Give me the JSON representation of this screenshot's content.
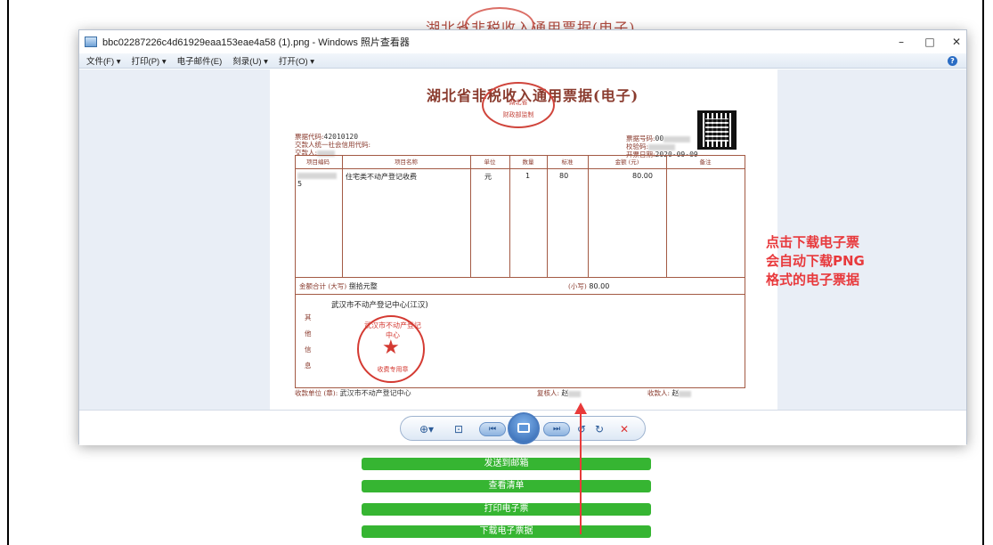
{
  "background": {
    "title": "湖北省非税收入通用票据(电子)"
  },
  "window": {
    "title": "bbc02287226c4d61929eaa153eae4a58 (1).png - Windows 照片查看器",
    "minimize": "–",
    "maximize": "□",
    "close": "✕",
    "help": "?",
    "menu": [
      "文件(F) ▾",
      "打印(P) ▾",
      "电子邮件(E)",
      "刻录(U) ▾",
      "打开(O) ▾"
    ]
  },
  "receipt": {
    "title": "湖北省非税收入通用票据(电子)",
    "seal_text": [
      "湖北省",
      "财政部监制"
    ],
    "left_info": {
      "code_label": "票据代码:",
      "code_value": "42010120",
      "payer_credit_label": "交款人统一社会信用代码:",
      "payer_label": "交款人:"
    },
    "right_info": {
      "number_label": "票据号码:",
      "number_value": "00",
      "check_label": "校验码:",
      "date_label": "开票日期:",
      "date_value": "2020-09-09"
    },
    "headers": [
      "项目编码",
      "项目名称",
      "单位",
      "数量",
      "标准",
      "金额 (元)",
      "备注"
    ],
    "row": {
      "code_tail": "5",
      "name": "住宅类不动产登记收费",
      "unit": "元",
      "qty": "1",
      "standard": "80",
      "amount": "80.00"
    },
    "total_label": "金额合计 (大写)",
    "total_words": "捌拾元整",
    "total_small_label": "(小写)",
    "total_small": "80.00",
    "other_info_label": [
      "其",
      "他",
      "信",
      "息"
    ],
    "other_info": "武汉市不动产登记中心(江汉)",
    "payee_unit_label": "收款单位 (章):",
    "payee_unit": "武汉市不动产登记中心",
    "reviewer_label": "复核人:",
    "reviewer": "赵",
    "collector_label": "收款人:",
    "collector": "赵",
    "stamp_text": "武汉市不动产登记中心",
    "stamp_sub": "收费专用章"
  },
  "annotation": {
    "lines": [
      "点击下载电子票",
      "会自动下载PNG",
      "格式的电子票据"
    ]
  },
  "buttons": {
    "email": "发送到邮箱",
    "list": "查看清单",
    "print": "打印电子票",
    "download": "下载电子票据"
  },
  "colors": {
    "annotation": "#e8393c",
    "button": "#36b532",
    "receipt_ink": "#8a3b2e",
    "stamp": "#d43a32"
  }
}
